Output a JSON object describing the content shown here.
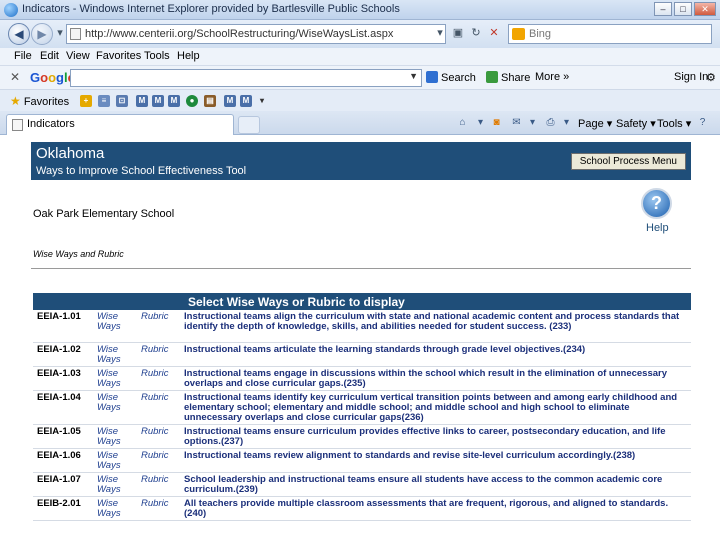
{
  "window": {
    "title": "Indicators - Windows Internet Explorer provided by Bartlesville Public Schools"
  },
  "address": {
    "url": "http://www.centerii.org/SchoolRestructuring/WiseWaysList.aspx",
    "search_placeholder": "Bing"
  },
  "menu": [
    "File",
    "Edit",
    "View",
    "Favorites",
    "Tools",
    "Help"
  ],
  "google": {
    "logo": [
      "G",
      "o",
      "o",
      "g",
      "l",
      "e"
    ],
    "search_label": "Search",
    "share_label": "Share",
    "more_label": "More »",
    "signin_label": "Sign In"
  },
  "favorites": {
    "label": "Favorites"
  },
  "tab": {
    "title": "Indicators"
  },
  "commands": {
    "page": "Page",
    "safety": "Safety",
    "tools": "Tools"
  },
  "page": {
    "state": "Oklahoma",
    "subtitle": "Ways to Improve School Effectiveness Tool",
    "menu_button": "School Process Menu",
    "school": "Oak Park Elementary School",
    "help": "Help",
    "section": "Wise Ways and Rubric"
  },
  "table": {
    "header": "Select Wise Ways or Rubric to display",
    "link1": "Wise Ways",
    "link2": "Rubric",
    "rows": [
      {
        "code": "EEIA-1.01",
        "desc": "Instructional teams align the curriculum with state and national academic content and process standards that identify the depth of knowledge, skills, and abilities needed for student success. (233)"
      },
      {
        "code": "EEIA-1.02",
        "desc": "Instructional teams articulate the learning standards through grade level objectives.(234)"
      },
      {
        "code": "EEIA-1.03",
        "desc": "Instructional teams engage in discussions within the school which result in the elimination of unnecessary overlaps and close curricular gaps.(235)"
      },
      {
        "code": "EEIA-1.04",
        "desc": "Instructional teams identify key curriculum vertical transition points between and among early childhood and elementary school; elementary and middle school; and middle school and high school to eliminate unnecessary overlaps and close curricular gaps(236)"
      },
      {
        "code": "EEIA-1.05",
        "desc": "Instructional teams ensure curriculum provides effective links to career, postsecondary education, and life options.(237)"
      },
      {
        "code": "EEIA-1.06",
        "desc": "Instructional teams review alignment to standards and revise site-level curriculum accordingly.(238)"
      },
      {
        "code": "EEIA-1.07",
        "desc": "School leadership and instructional teams ensure all students have access to the common academic core curriculum.(239)"
      },
      {
        "code": "EEIB-2.01",
        "desc": "All teachers provide multiple classroom assessments that are frequent, rigorous, and aligned to standards.(240)"
      }
    ]
  },
  "colors": {
    "header_bg": "#1f4e79",
    "link": "#1f3f8f"
  }
}
